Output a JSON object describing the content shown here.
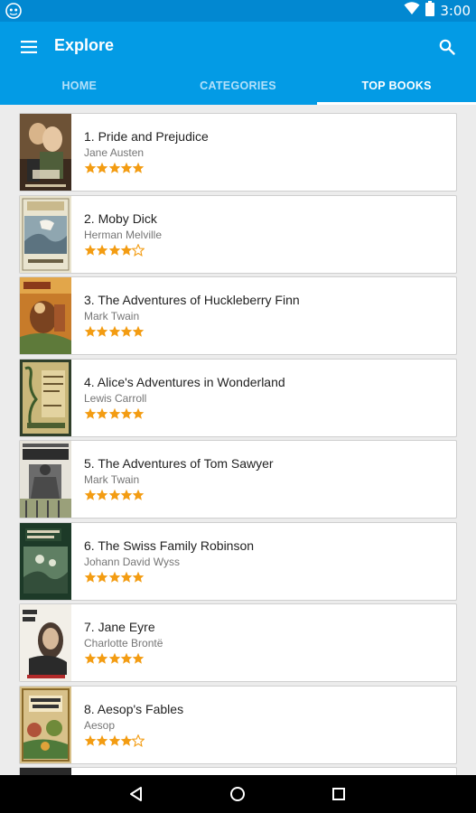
{
  "status_bar": {
    "time": "3:00",
    "icons": [
      "app-notification-icon",
      "wifi-icon",
      "battery-icon"
    ]
  },
  "app_bar": {
    "title": "Explore",
    "menu_icon": "hamburger-menu-icon",
    "search_icon": "search-icon"
  },
  "tabs": [
    {
      "label": "HOME",
      "active": false
    },
    {
      "label": "CATEGORIES",
      "active": false
    },
    {
      "label": "TOP BOOKS",
      "active": true
    }
  ],
  "books": [
    {
      "title": "1. Pride and Prejudice",
      "author": "Jane Austen",
      "rating": 5
    },
    {
      "title": "2. Moby Dick",
      "author": "Herman Melville",
      "rating": 4
    },
    {
      "title": "3. The Adventures of Huckleberry Finn",
      "author": "Mark Twain",
      "rating": 5
    },
    {
      "title": "4. Alice's Adventures in Wonderland",
      "author": "Lewis Carroll",
      "rating": 5
    },
    {
      "title": "5. The Adventures of Tom Sawyer",
      "author": "Mark Twain",
      "rating": 5
    },
    {
      "title": "6. The Swiss Family Robinson",
      "author": "Johann David Wyss",
      "rating": 5
    },
    {
      "title": "7. Jane Eyre",
      "author": "Charlotte Brontë",
      "rating": 5
    },
    {
      "title": "8. Aesop's Fables",
      "author": "Aesop",
      "rating": 4
    }
  ],
  "rating_max": 5,
  "colors": {
    "status_bar": "#0288d1",
    "app_bar": "#039be5",
    "star": "#f39c12",
    "nav_bar": "#000000"
  },
  "nav_bar": {
    "icons": [
      "back-icon",
      "home-icon",
      "recents-icon"
    ]
  }
}
